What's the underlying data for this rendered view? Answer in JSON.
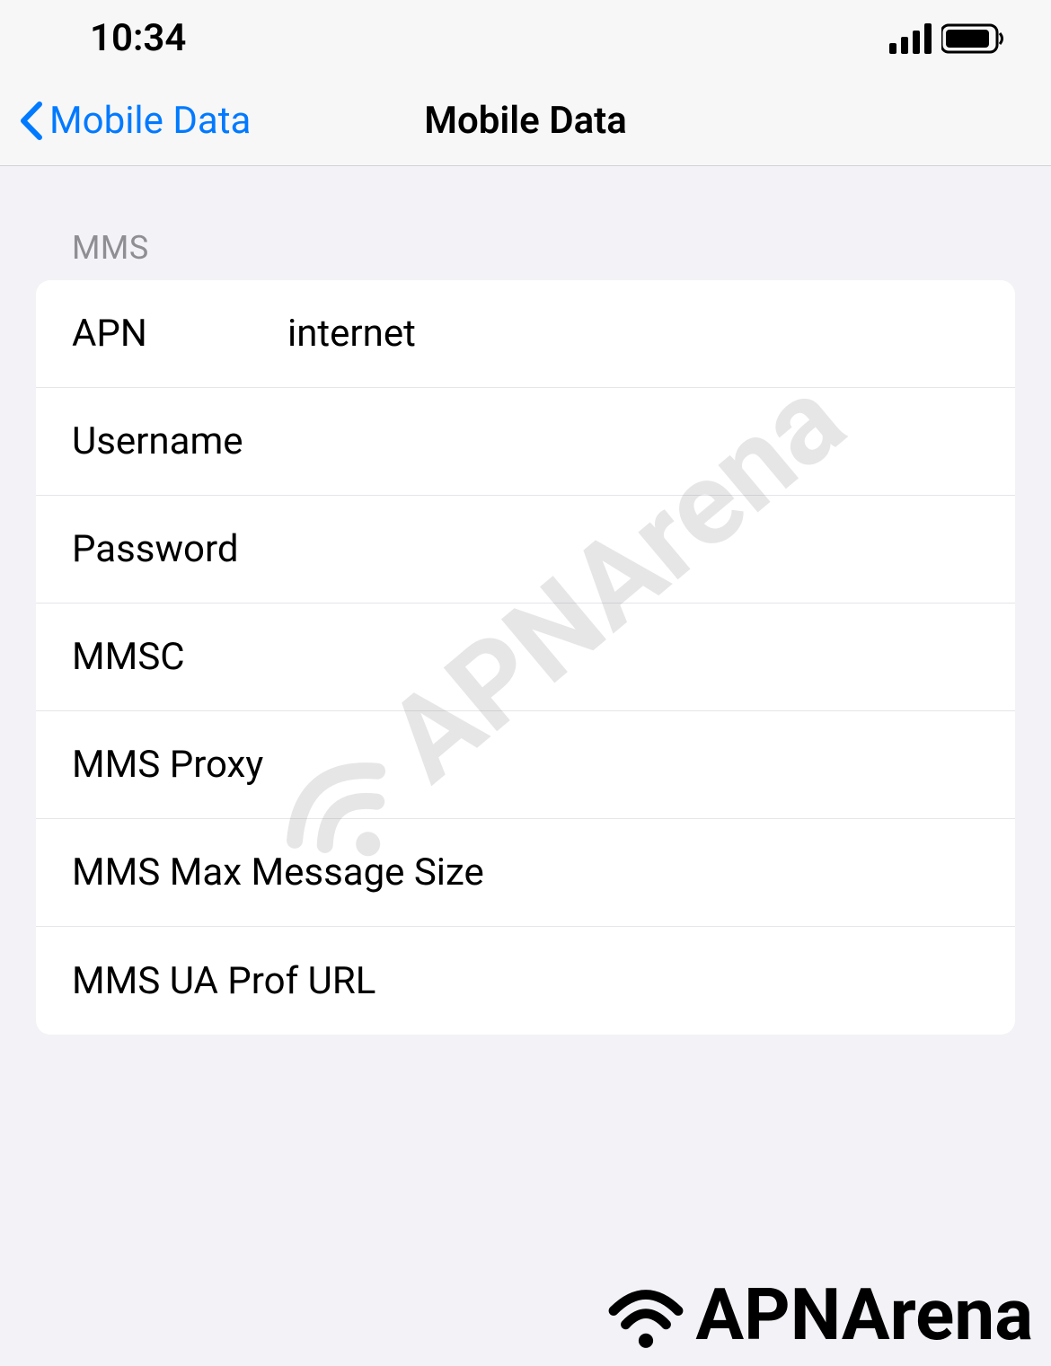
{
  "status": {
    "time": "10:34"
  },
  "nav": {
    "back_label": "Mobile Data",
    "title": "Mobile Data"
  },
  "section": {
    "header": "MMS",
    "rows": {
      "apn": {
        "label": "APN",
        "value": "internet"
      },
      "username": {
        "label": "Username",
        "value": ""
      },
      "password": {
        "label": "Password",
        "value": ""
      },
      "mmsc": {
        "label": "MMSC",
        "value": ""
      },
      "mms_proxy": {
        "label": "MMS Proxy",
        "value": ""
      },
      "mms_max": {
        "label": "MMS Max Message Size",
        "value": ""
      },
      "mms_ua": {
        "label": "MMS UA Prof URL",
        "value": ""
      }
    }
  },
  "watermark": "APNArena",
  "brand": "APNArena"
}
